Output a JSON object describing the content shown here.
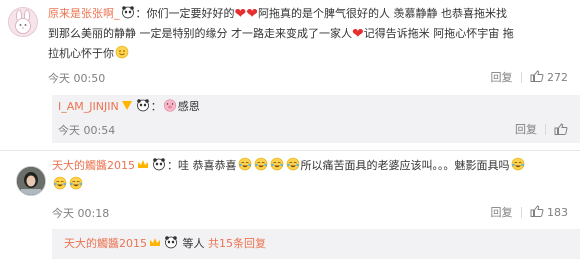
{
  "comment1": {
    "username": "原来是张张啊_",
    "text_a": "你们一定要好好的",
    "text_b": "阿拖真的是个脾气很好的人 羡慕静静 也恭喜拖米找",
    "text_c": "到那么美丽的静静 一定是特别的缘分 才一路走来变成了一家人",
    "text_d": "记得告诉拖米 阿拖心怀宇宙 拖",
    "text_e": "拉机心怀于你",
    "time": "今天 00:50",
    "reply_label": "回复",
    "like_count": "272"
  },
  "reply1": {
    "username": "I_AM_JINJIN",
    "text": "感恩",
    "time": "今天 00:54",
    "reply_label": "回复",
    "like_label": ""
  },
  "comment2": {
    "username": "天大的觸醬2015",
    "text_a": "哇 恭喜恭喜",
    "text_b": "所以痛苦面具的老婆应该叫。。。魅影面具吗",
    "time": "今天 00:18",
    "reply_label": "回复",
    "like_count": "183"
  },
  "more": {
    "username": "天大的觸醬2015",
    "text_a": "等人",
    "link": "共15条回复"
  },
  "colors": {
    "accent": "#eb7350",
    "meta": "#808080",
    "reply_bg": "#f2f2f5",
    "heart": "#e62e2e"
  }
}
